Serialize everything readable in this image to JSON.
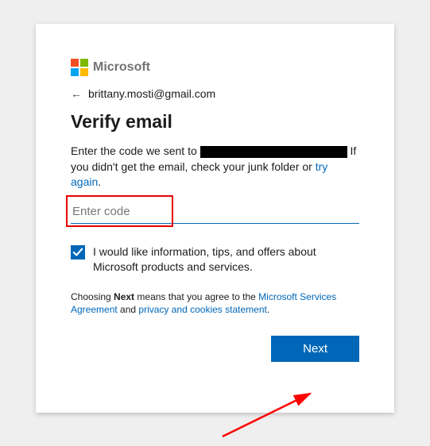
{
  "brand": "Microsoft",
  "email": "brittany.mosti@gmail.com",
  "title": "Verify email",
  "desc_before": "Enter the code we sent to ",
  "desc_after": " If you didn't get the email, check your junk folder or ",
  "try_again": "try again",
  "input_placeholder": "Enter code",
  "checkbox_label": "I would like information, tips, and offers about Microsoft products and services.",
  "legal_before": "Choosing ",
  "legal_bold": "Next",
  "legal_mid": " means that you agree to the ",
  "legal_link1": "Microsoft Services Agreement",
  "legal_and": " and ",
  "legal_link2": "privacy and cookies statement",
  "legal_end": ".",
  "next_label": "Next"
}
